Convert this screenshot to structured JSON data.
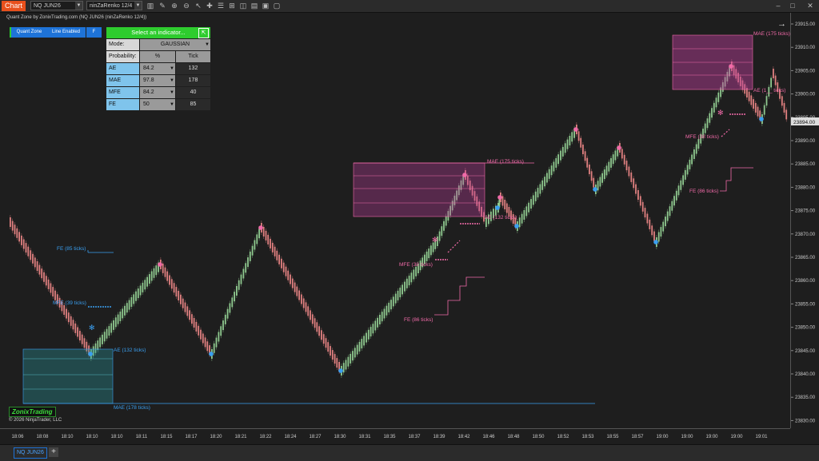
{
  "toolbar": {
    "chart_tab": "Chart",
    "instrument": "NQ JUN26",
    "bar_type": "ninZaRenko 12/4"
  },
  "attribution": "Quant Zone by ZonixTrading.com (NQ JUN26 (ninZaRenko 12/4))",
  "quant_buttons": [
    {
      "label": "Quant Zone"
    },
    {
      "label": "Line Enabled"
    },
    {
      "label": "F"
    }
  ],
  "panel": {
    "header": "Select an indicator...",
    "mode_label": "Mode:",
    "mode_value": "GAUSSIAN",
    "col_prob": "Probability:",
    "col_pct": "%",
    "col_tick": "Tick",
    "rows": [
      {
        "name": "AE",
        "pct": "84.2",
        "tick": "132"
      },
      {
        "name": "MAE",
        "pct": "97.8",
        "tick": "178"
      },
      {
        "name": "MFE",
        "pct": "84.2",
        "tick": "40"
      },
      {
        "name": "FE",
        "pct": "50",
        "tick": "85"
      }
    ]
  },
  "colors": {
    "up": "#8fc98f",
    "down": "#e08080",
    "blue": "#3a9ff0",
    "pink": "#f06aa8",
    "magenta": "#c040a0",
    "teal": "#2a9aa0"
  },
  "y_axis": {
    "labels": [
      "23915.00",
      "23910.00",
      "23905.00",
      "23900.00",
      "23895.00",
      "23890.00",
      "23885.00",
      "23880.00",
      "23875.00",
      "23870.00",
      "23865.00",
      "23860.00",
      "23855.00",
      "23850.00",
      "23845.00",
      "23840.00",
      "23835.00",
      "23830.00"
    ],
    "current_price": "23894.00"
  },
  "x_axis": {
    "labels": [
      "18:06",
      "18:08",
      "18:10",
      "18:10",
      "18:10",
      "18:11",
      "18:15",
      "18:17",
      "18:20",
      "18:21",
      "18:22",
      "18:24",
      "18:27",
      "18:30",
      "18:31",
      "18:35",
      "18:37",
      "18:39",
      "18:42",
      "18:46",
      "18:48",
      "18:50",
      "18:52",
      "18:53",
      "18:55",
      "18:57",
      "19:00",
      "19:00",
      "19:00",
      "19:00",
      "19:01"
    ]
  },
  "annotations": {
    "fe_blue": "FE (85 ticks)",
    "mfe_blue": "MFE (39 ticks)",
    "ae_blue": "AE (132 ticks)",
    "mae_blue": "MAE (178 ticks)",
    "mae_pink_mid": "MAE (175 ticks)",
    "ae_pink_mid": "AE (132 ticks)",
    "mfe_pink_mid": "MFE (38 ticks)",
    "fe_pink_mid": "FE (86 ticks)",
    "mae_pink_top": "MAE (175 ticks)",
    "ae_pink_top": "AE (1__ ticks)",
    "mfe_pink_top": "MFE (38 ticks)",
    "fe_pink_top": "FE (86 ticks)"
  },
  "brand": "ZonixTrading",
  "copyright": "© 2026 NinjaTrader, LLC",
  "bottom_tab": "NQ JUN26"
}
